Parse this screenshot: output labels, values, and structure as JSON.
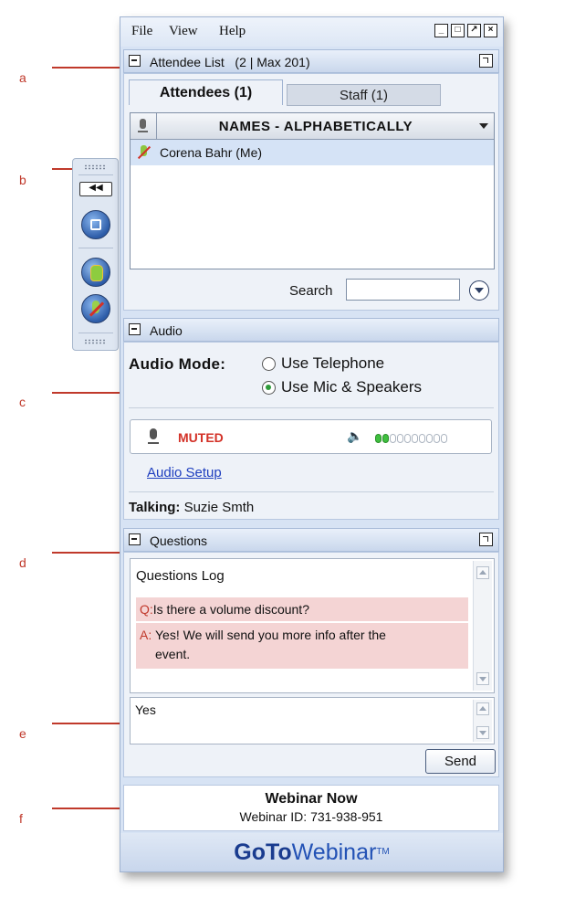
{
  "annotations": [
    "a",
    "b",
    "c",
    "d",
    "e",
    "f"
  ],
  "menu": [
    "File",
    "View",
    "Help"
  ],
  "window_buttons": [
    "minimize-icon",
    "maximize-icon",
    "restore-icon",
    "close-icon"
  ],
  "attendee_panel": {
    "title": "Attendee List",
    "count": "(2 | Max 201)",
    "tabs": [
      "Attendees (1)",
      "Staff (1)"
    ],
    "column_header": "NAMES - ALPHABETICALLY",
    "rows": [
      "Corena Bahr (Me)"
    ],
    "search_label": "Search",
    "search_value": ""
  },
  "audio_panel": {
    "title": "Audio",
    "mode_label": "Audio Mode:",
    "options": [
      "Use Telephone",
      "Use Mic & Speakers"
    ],
    "selected_option": "Use Mic & Speakers",
    "status": "MUTED",
    "level_active": 2,
    "level_total": 10,
    "setup_link": "Audio Setup",
    "talking_label": "Talking:",
    "talking_name": "Suzie Smth"
  },
  "questions_panel": {
    "title": "Questions",
    "log_title": "Questions Log",
    "question_prefix": "Q:",
    "question": "Is there a volume discount?",
    "answer_prefix": "A:",
    "answer_line1": "Yes! We will send you more info after the",
    "answer_line2": "event.",
    "input_value": "Yes",
    "send_label": "Send"
  },
  "webinar": {
    "title": "Webinar Now",
    "id_label": "Webinar ID: 731-938-951"
  },
  "brand": {
    "goto": "GoTo",
    "webinar": "Webinar",
    "tm": "TM"
  },
  "colors": {
    "annotation": "#c0392b",
    "muted": "#d33127",
    "link": "#1f3fbf",
    "brand": "#1a3c8f"
  }
}
